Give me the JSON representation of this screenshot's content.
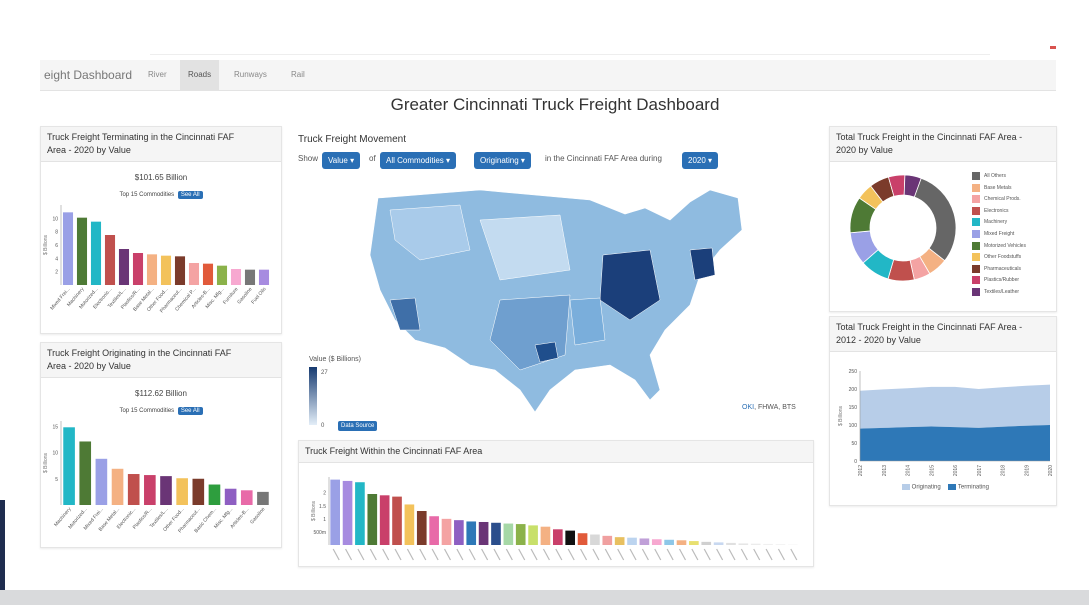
{
  "navbar": {
    "brand": "eight Dashboard",
    "tabs": [
      {
        "label": "River"
      },
      {
        "label": "Roads"
      },
      {
        "label": "Runways"
      },
      {
        "label": "Rail"
      }
    ],
    "active_tab": "Roads"
  },
  "page_title": "Greater Cincinnati Truck Freight Dashboard",
  "terminating_panel": {
    "title_line1": "Truck Freight Terminating in the Cincinnati FAF",
    "title_line2": "Area - 2020 by Value",
    "total": "$101.65 Billion",
    "top_label": "Top 15 Commodities",
    "see_all": "See All",
    "ylabel": "$ Billions"
  },
  "originating_panel": {
    "title_line1": "Truck Freight Originating in the Cincinnati FAF",
    "title_line2": "Area - 2020 by Value",
    "total": "$112.62 Billion",
    "top_label": "Top 15 Commodities",
    "see_all": "See All",
    "ylabel": "$ Billions"
  },
  "movement_panel": {
    "title": "Truck Freight Movement",
    "show_label": "Show",
    "of_label": "of",
    "in_label": "in the Cincinnati FAF Area during",
    "value_btn": "Value",
    "commodity_btn": "All Commodities",
    "direction_btn": "Originating",
    "year_btn": "2020",
    "legend_title": "Value ($ Billions)",
    "legend_max": "27",
    "legend_min": "0",
    "data_source_btn": "Data Source",
    "attribution_link": "OKI",
    "attribution_rest": ", FHWA, BTS"
  },
  "within_panel": {
    "title": "Truck Freight Within the Cincinnati FAF Area",
    "ylabel": "$ Billions"
  },
  "donut_panel": {
    "title_line1": "Total Truck Freight in the Cincinnati FAF Area -",
    "title_line2": "2020 by Value",
    "legend": [
      {
        "label": "All Others",
        "color": "#666666"
      },
      {
        "label": "Base Metals",
        "color": "#f4b183"
      },
      {
        "label": "Chemical Prods.",
        "color": "#f4a3a3"
      },
      {
        "label": "Electronics",
        "color": "#c0504d"
      },
      {
        "label": "Machinery",
        "color": "#22b7c6"
      },
      {
        "label": "Mixed Freight",
        "color": "#9aa0e6"
      },
      {
        "label": "Motorized Vehicles",
        "color": "#4e7a35"
      },
      {
        "label": "Other Foodstuffs",
        "color": "#f3c25b"
      },
      {
        "label": "Pharmaceuticals",
        "color": "#7b3b2b"
      },
      {
        "label": "Plastics/Rubber",
        "color": "#c9406a"
      },
      {
        "label": "Textiles/Leather",
        "color": "#6a3576"
      }
    ]
  },
  "area_panel": {
    "title_line1": "Total Truck Freight in the Cincinnati FAF Area -",
    "title_line2": "2012 - 2020 by Value",
    "ylabel": "$ Billions",
    "legend_originating": "Originating",
    "legend_terminating": "Terminating",
    "color_originating": "#b7cde8",
    "color_terminating": "#2e78b7"
  },
  "chart_data": [
    {
      "type": "bar",
      "id": "terminating",
      "ylim": [
        0,
        12
      ],
      "yticks": [
        2,
        4,
        6,
        8,
        10
      ],
      "categories": [
        "Mixed Frei...",
        "Machinery",
        "Motorized...",
        "Electronic...",
        "Textiles/L...",
        "Plastics/R...",
        "Base Metal...",
        "Other Food...",
        "Pharmaceut...",
        "Chemical P...",
        "Articles-B...",
        "Misc. Mfg...",
        "Furniture",
        "Gasoline",
        "Fuel Oils"
      ],
      "values": [
        10.9,
        10.1,
        9.5,
        7.5,
        5.4,
        4.8,
        4.6,
        4.4,
        4.3,
        3.3,
        3.2,
        2.9,
        2.4,
        2.3,
        2.3
      ],
      "colors": [
        "#9aa0e6",
        "#4e7a35",
        "#22b7c6",
        "#c0504d",
        "#6a3576",
        "#c9406a",
        "#f4b183",
        "#f3c25b",
        "#7b3b2b",
        "#f4a3a3",
        "#e15a3a",
        "#8bb24a",
        "#f7a8d0",
        "#777777",
        "#a78be0"
      ]
    },
    {
      "type": "bar",
      "id": "originating",
      "ylim": [
        0,
        16
      ],
      "yticks": [
        5,
        10,
        15
      ],
      "categories": [
        "Machinery",
        "Motorized...",
        "Mixed Frei...",
        "Base Metal...",
        "Electronic...",
        "Plastics/R...",
        "Textiles/L...",
        "Other Food...",
        "Pharmaceut...",
        "Basic Chem...",
        "Misc. Mfg...",
        "Articles-B...",
        "Gasoline"
      ],
      "values": [
        14.8,
        12.1,
        8.8,
        6.9,
        5.9,
        5.7,
        5.5,
        5.1,
        5.0,
        3.9,
        3.1,
        2.8,
        2.5
      ],
      "colors": [
        "#22b7c6",
        "#4e7a35",
        "#9aa0e6",
        "#f4b183",
        "#c0504d",
        "#c9406a",
        "#6a3576",
        "#f3c25b",
        "#7b3b2b",
        "#2e9e3e",
        "#8e5fc2",
        "#e86aa8",
        "#777777"
      ]
    },
    {
      "type": "bar",
      "id": "within",
      "ylim": [
        0,
        2.6
      ],
      "ytick_labels": [
        "500m",
        "1",
        "1.5",
        "2"
      ],
      "yticks": [
        0.5,
        1,
        1.5,
        2
      ],
      "values": [
        2.5,
        2.45,
        2.4,
        1.95,
        1.9,
        1.85,
        1.55,
        1.3,
        1.1,
        1.0,
        0.95,
        0.9,
        0.88,
        0.85,
        0.82,
        0.8,
        0.75,
        0.7,
        0.6,
        0.55,
        0.45,
        0.4,
        0.35,
        0.3,
        0.28,
        0.25,
        0.22,
        0.2,
        0.18,
        0.15,
        0.12,
        0.1,
        0.08,
        0.06,
        0.05,
        0.04,
        0.03,
        0.02
      ],
      "colors": [
        "#9aa0e6",
        "#a78be0",
        "#22b7c6",
        "#4e7a35",
        "#c9406a",
        "#c0504d",
        "#f3c25b",
        "#7b3b2b",
        "#e86aa8",
        "#f4a3a3",
        "#8e5fc2",
        "#2e78b7",
        "#6a3576",
        "#2b4e8c",
        "#a6d8a6",
        "#8bb24a",
        "#c8e06a",
        "#f4b183",
        "#c9406a",
        "#111111",
        "#e15a3a",
        "#d8d8d8",
        "#f0a0a0",
        "#e8c060",
        "#bcd4ef",
        "#c0a0d8",
        "#f7a8d0",
        "#8ec7e8",
        "#f4b183",
        "#e8e070",
        "#d0d0d0",
        "#c8d8f0",
        "#e0e0e0",
        "#e6e6e6",
        "#ececec",
        "#f0f0f0",
        "#f2f2f2",
        "#f4f4f4"
      ]
    },
    {
      "type": "pie",
      "id": "donut",
      "labels": [
        "All Others",
        "Base Metals",
        "Chemical Prods.",
        "Electronics",
        "Machinery",
        "Mixed Freight",
        "Motorized Vehicles",
        "Other Foodstuffs",
        "Pharmaceuticals",
        "Plastics/Rubber",
        "Textiles/Leather"
      ],
      "values": [
        30,
        6,
        5,
        8,
        9,
        10,
        11,
        5,
        6,
        5,
        5
      ]
    },
    {
      "type": "area",
      "id": "trend",
      "ylim": [
        0,
        250
      ],
      "yticks": [
        0,
        50,
        100,
        150,
        200,
        250
      ],
      "x": [
        "2012",
        "2013",
        "2014",
        "2015",
        "2016",
        "2017",
        "2018",
        "2019",
        "2020"
      ],
      "series": [
        {
          "name": "Terminating",
          "values": [
            90,
            92,
            94,
            96,
            94,
            92,
            95,
            98,
            100
          ]
        },
        {
          "name": "Originating",
          "values": [
            105,
            107,
            108,
            110,
            112,
            108,
            110,
            111,
            112
          ]
        }
      ]
    }
  ]
}
